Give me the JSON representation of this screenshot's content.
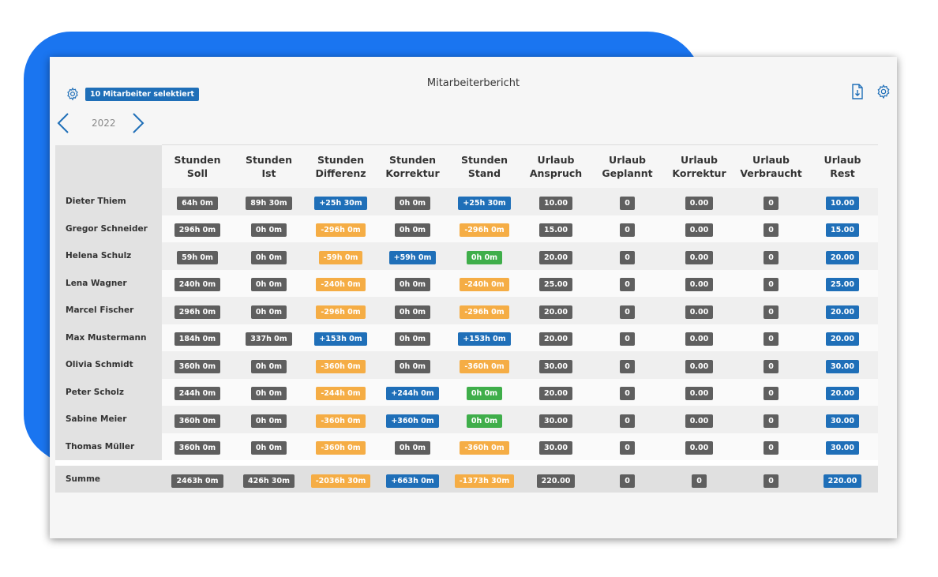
{
  "header": {
    "title": "Mitarbeiterbericht",
    "selection_badge": "10 Mitarbeiter selektiert",
    "year": "2022",
    "icons": [
      "gear-icon",
      "document-icon",
      "chevron-left-icon",
      "chevron-right-icon"
    ]
  },
  "colors": {
    "gray": "#5f5f5f",
    "blue": "#1f6fb8",
    "orange": "#f5ad45",
    "green": "#3fae4a",
    "backdrop": "#1a75f0"
  },
  "columns": [
    [
      "Stunden",
      "Soll"
    ],
    [
      "Stunden",
      "Ist"
    ],
    [
      "Stunden",
      "Differenz"
    ],
    [
      "Stunden",
      "Korrektur"
    ],
    [
      "Stunden",
      "Stand"
    ],
    [
      "Urlaub",
      "Anspruch"
    ],
    [
      "Urlaub",
      "Geplannt"
    ],
    [
      "Urlaub",
      "Korrektur"
    ],
    [
      "Urlaub",
      "Verbraucht"
    ],
    [
      "Urlaub",
      "Rest"
    ]
  ],
  "rows": [
    {
      "name": "Dieter Thiem",
      "cells": [
        {
          "v": "64h 0m",
          "c": "gray"
        },
        {
          "v": "89h 30m",
          "c": "gray"
        },
        {
          "v": "+25h 30m",
          "c": "blue"
        },
        {
          "v": "0h 0m",
          "c": "gray"
        },
        {
          "v": "+25h 30m",
          "c": "blue"
        },
        {
          "v": "10.00",
          "c": "gray"
        },
        {
          "v": "0",
          "c": "gray"
        },
        {
          "v": "0.00",
          "c": "gray"
        },
        {
          "v": "0",
          "c": "gray"
        },
        {
          "v": "10.00",
          "c": "blue"
        }
      ]
    },
    {
      "name": "Gregor Schneider",
      "cells": [
        {
          "v": "296h 0m",
          "c": "gray"
        },
        {
          "v": "0h 0m",
          "c": "gray"
        },
        {
          "v": "-296h 0m",
          "c": "orange"
        },
        {
          "v": "0h 0m",
          "c": "gray"
        },
        {
          "v": "-296h 0m",
          "c": "orange"
        },
        {
          "v": "15.00",
          "c": "gray"
        },
        {
          "v": "0",
          "c": "gray"
        },
        {
          "v": "0.00",
          "c": "gray"
        },
        {
          "v": "0",
          "c": "gray"
        },
        {
          "v": "15.00",
          "c": "blue"
        }
      ]
    },
    {
      "name": "Helena Schulz",
      "cells": [
        {
          "v": "59h 0m",
          "c": "gray"
        },
        {
          "v": "0h 0m",
          "c": "gray"
        },
        {
          "v": "-59h 0m",
          "c": "orange"
        },
        {
          "v": "+59h 0m",
          "c": "blue"
        },
        {
          "v": "0h 0m",
          "c": "green"
        },
        {
          "v": "20.00",
          "c": "gray"
        },
        {
          "v": "0",
          "c": "gray"
        },
        {
          "v": "0.00",
          "c": "gray"
        },
        {
          "v": "0",
          "c": "gray"
        },
        {
          "v": "20.00",
          "c": "blue"
        }
      ]
    },
    {
      "name": "Lena Wagner",
      "cells": [
        {
          "v": "240h 0m",
          "c": "gray"
        },
        {
          "v": "0h 0m",
          "c": "gray"
        },
        {
          "v": "-240h 0m",
          "c": "orange"
        },
        {
          "v": "0h 0m",
          "c": "gray"
        },
        {
          "v": "-240h 0m",
          "c": "orange"
        },
        {
          "v": "25.00",
          "c": "gray"
        },
        {
          "v": "0",
          "c": "gray"
        },
        {
          "v": "0.00",
          "c": "gray"
        },
        {
          "v": "0",
          "c": "gray"
        },
        {
          "v": "25.00",
          "c": "blue"
        }
      ]
    },
    {
      "name": "Marcel Fischer",
      "cells": [
        {
          "v": "296h 0m",
          "c": "gray"
        },
        {
          "v": "0h 0m",
          "c": "gray"
        },
        {
          "v": "-296h 0m",
          "c": "orange"
        },
        {
          "v": "0h 0m",
          "c": "gray"
        },
        {
          "v": "-296h 0m",
          "c": "orange"
        },
        {
          "v": "20.00",
          "c": "gray"
        },
        {
          "v": "0",
          "c": "gray"
        },
        {
          "v": "0.00",
          "c": "gray"
        },
        {
          "v": "0",
          "c": "gray"
        },
        {
          "v": "20.00",
          "c": "blue"
        }
      ]
    },
    {
      "name": "Max Mustermann",
      "cells": [
        {
          "v": "184h 0m",
          "c": "gray"
        },
        {
          "v": "337h 0m",
          "c": "gray"
        },
        {
          "v": "+153h 0m",
          "c": "blue"
        },
        {
          "v": "0h 0m",
          "c": "gray"
        },
        {
          "v": "+153h 0m",
          "c": "blue"
        },
        {
          "v": "20.00",
          "c": "gray"
        },
        {
          "v": "0",
          "c": "gray"
        },
        {
          "v": "0.00",
          "c": "gray"
        },
        {
          "v": "0",
          "c": "gray"
        },
        {
          "v": "20.00",
          "c": "blue"
        }
      ]
    },
    {
      "name": "Olivia Schmidt",
      "cells": [
        {
          "v": "360h 0m",
          "c": "gray"
        },
        {
          "v": "0h 0m",
          "c": "gray"
        },
        {
          "v": "-360h 0m",
          "c": "orange"
        },
        {
          "v": "0h 0m",
          "c": "gray"
        },
        {
          "v": "-360h 0m",
          "c": "orange"
        },
        {
          "v": "30.00",
          "c": "gray"
        },
        {
          "v": "0",
          "c": "gray"
        },
        {
          "v": "0.00",
          "c": "gray"
        },
        {
          "v": "0",
          "c": "gray"
        },
        {
          "v": "30.00",
          "c": "blue"
        }
      ]
    },
    {
      "name": "Peter Scholz",
      "cells": [
        {
          "v": "244h 0m",
          "c": "gray"
        },
        {
          "v": "0h 0m",
          "c": "gray"
        },
        {
          "v": "-244h 0m",
          "c": "orange"
        },
        {
          "v": "+244h 0m",
          "c": "blue"
        },
        {
          "v": "0h 0m",
          "c": "green"
        },
        {
          "v": "20.00",
          "c": "gray"
        },
        {
          "v": "0",
          "c": "gray"
        },
        {
          "v": "0.00",
          "c": "gray"
        },
        {
          "v": "0",
          "c": "gray"
        },
        {
          "v": "20.00",
          "c": "blue"
        }
      ]
    },
    {
      "name": "Sabine Meier",
      "cells": [
        {
          "v": "360h 0m",
          "c": "gray"
        },
        {
          "v": "0h 0m",
          "c": "gray"
        },
        {
          "v": "-360h 0m",
          "c": "orange"
        },
        {
          "v": "+360h 0m",
          "c": "blue"
        },
        {
          "v": "0h 0m",
          "c": "green"
        },
        {
          "v": "30.00",
          "c": "gray"
        },
        {
          "v": "0",
          "c": "gray"
        },
        {
          "v": "0.00",
          "c": "gray"
        },
        {
          "v": "0",
          "c": "gray"
        },
        {
          "v": "30.00",
          "c": "blue"
        }
      ]
    },
    {
      "name": "Thomas Müller",
      "cells": [
        {
          "v": "360h 0m",
          "c": "gray"
        },
        {
          "v": "0h 0m",
          "c": "gray"
        },
        {
          "v": "-360h 0m",
          "c": "orange"
        },
        {
          "v": "0h 0m",
          "c": "gray"
        },
        {
          "v": "-360h 0m",
          "c": "orange"
        },
        {
          "v": "30.00",
          "c": "gray"
        },
        {
          "v": "0",
          "c": "gray"
        },
        {
          "v": "0.00",
          "c": "gray"
        },
        {
          "v": "0",
          "c": "gray"
        },
        {
          "v": "30.00",
          "c": "blue"
        }
      ]
    }
  ],
  "sum_row": {
    "name": "Summe",
    "cells": [
      {
        "v": "2463h 0m",
        "c": "gray"
      },
      {
        "v": "426h 30m",
        "c": "gray"
      },
      {
        "v": "-2036h 30m",
        "c": "orange"
      },
      {
        "v": "+663h 0m",
        "c": "blue"
      },
      {
        "v": "-1373h 30m",
        "c": "orange"
      },
      {
        "v": "220.00",
        "c": "gray"
      },
      {
        "v": "0",
        "c": "gray"
      },
      {
        "v": "0",
        "c": "gray"
      },
      {
        "v": "0",
        "c": "gray"
      },
      {
        "v": "220.00",
        "c": "blue"
      }
    ]
  }
}
